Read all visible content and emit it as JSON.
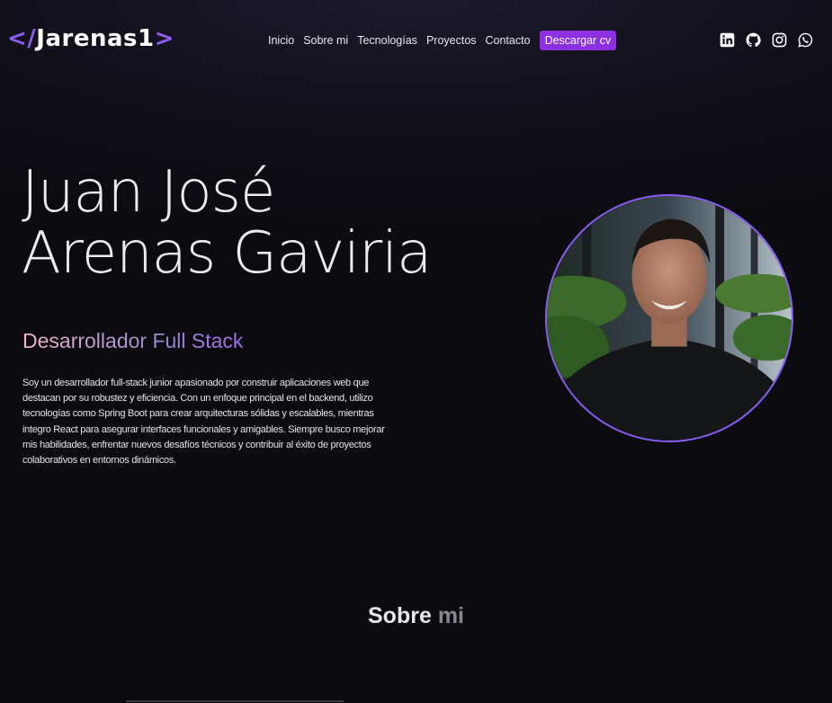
{
  "logo": {
    "open": "</",
    "name": "Jarenas1",
    "close": ">"
  },
  "nav": {
    "items": [
      "Inicio",
      "Sobre mi",
      "Tecnologías",
      "Proyectos",
      "Contacto"
    ],
    "cv_label": "Descargar cv"
  },
  "social": {
    "icons": [
      "linkedin-icon",
      "github-icon",
      "instagram-icon",
      "whatsapp-icon"
    ]
  },
  "hero": {
    "name_line1": "Juan José",
    "name_line2": "Arenas Gaviria",
    "role": "Desarrollador Full Stack",
    "bio": "Soy un desarrollador full-stack junior apasionado por construir aplicaciones web que destacan por su robustez y eficiencia. Con un enfoque principal en el backend, utilizo tecnologías como Spring Boot para crear arquitecturas sólidas y escalables, mientras integro React para asegurar interfaces funcionales y amigables. Siempre busco mejorar mis habilidades, enfrentar nuevos desafíos técnicos y contribuir al éxito de proyectos colaborativos en entornos dinámicos."
  },
  "section": {
    "title_word1": "Sobre",
    "title_word2": "mi"
  },
  "colors": {
    "accent": "#8b5cf6",
    "cv_button": "#8b2fe0",
    "background": "#0c0b10"
  }
}
